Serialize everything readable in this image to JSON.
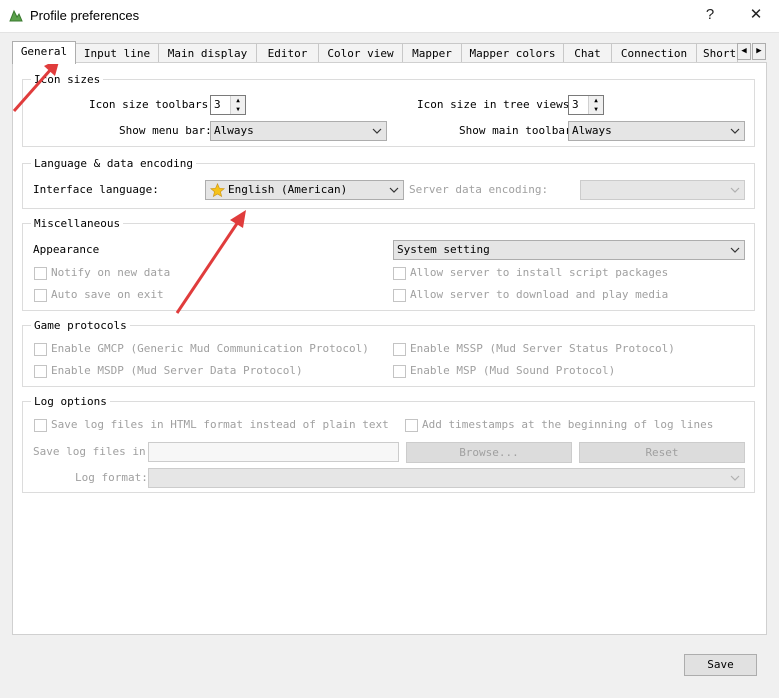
{
  "window": {
    "title": "Profile preferences",
    "help_label": "?",
    "close_label": "✕"
  },
  "tabs": [
    {
      "label": "General",
      "active": true
    },
    {
      "label": "Input line"
    },
    {
      "label": "Main display"
    },
    {
      "label": "Editor"
    },
    {
      "label": "Color view"
    },
    {
      "label": "Mapper"
    },
    {
      "label": "Mapper colors"
    },
    {
      "label": "Chat"
    },
    {
      "label": "Connection"
    },
    {
      "label": "Short"
    }
  ],
  "icon_sizes": {
    "title": "Icon sizes",
    "toolbars_label": "Icon size toolbars:",
    "toolbars_value": "3",
    "tree_label": "Icon size in tree views:",
    "tree_value": "3",
    "menu_bar_label": "Show menu bar:",
    "menu_bar_value": "Always",
    "main_toolbar_label": "Show main toolbar",
    "main_toolbar_value": "Always"
  },
  "language": {
    "title": "Language & data encoding",
    "interface_label": "Interface language:",
    "interface_value": "English (American)",
    "encoding_label": "Server data encoding:",
    "encoding_value": ""
  },
  "misc": {
    "title": "Miscellaneous",
    "appearance_label": "Appearance",
    "appearance_value": "System setting",
    "notify": "Notify on new data",
    "autosave": "Auto save on exit",
    "allow_scripts": "Allow server to install script packages",
    "allow_media": "Allow server to download and play media"
  },
  "protocols": {
    "title": "Game protocols",
    "gmcp": "Enable GMCP  (Generic Mud Communication Protocol)",
    "mssp": "Enable MSSP  (Mud Server Status Protocol)",
    "msdp": "Enable MSDP  (Mud Server Data Protocol)",
    "msp": "Enable MSP  (Mud Sound Protocol)"
  },
  "log": {
    "title": "Log options",
    "html_format": "Save log files in HTML format instead of plain text",
    "timestamps": "Add timestamps at the beginning of log lines",
    "save_in_label": "Save log files in:",
    "browse": "Browse...",
    "reset": "Reset",
    "format_label": "Log format:",
    "format_value": ""
  },
  "footer": {
    "save": "Save"
  },
  "colors": {
    "annotation_arrow": "#e03c3c",
    "star": "#f5c21a"
  }
}
